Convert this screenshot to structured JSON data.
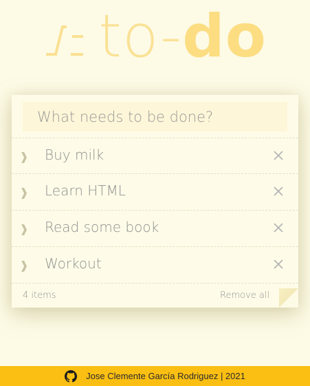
{
  "logo": {
    "mark": "/:",
    "text_light": "to-",
    "text_bold": "do"
  },
  "input": {
    "placeholder": "What needs to be done?"
  },
  "todos": [
    {
      "label": "Buy milk"
    },
    {
      "label": "Learn HTML"
    },
    {
      "label": "Read some book"
    },
    {
      "label": "Workout"
    }
  ],
  "footer": {
    "count": "4 items",
    "remove_all_label": "Remove all"
  },
  "site_footer": {
    "credit": "Jose Clemente García Rodriguez | 2021"
  },
  "icons": {
    "toggle": "chevron-right-icon",
    "destroy": "close-icon",
    "github": "github-icon"
  },
  "colors": {
    "background": "#fdfbe6",
    "card": "#fefce8",
    "input_bg": "#fdf6d8",
    "logo": "#fcdd82",
    "footer_bar": "#fbbf13",
    "text": "#8f8f8f"
  }
}
